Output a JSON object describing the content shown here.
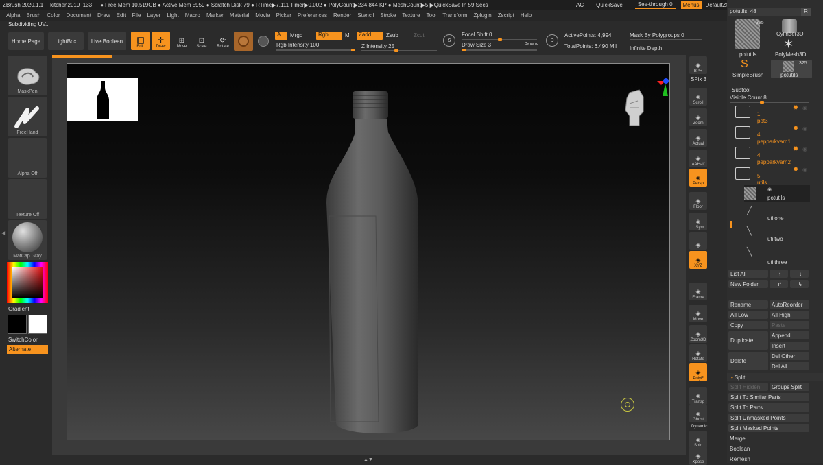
{
  "titlebar": {
    "app": "ZBrush 2020.1.1",
    "file": "kitchen2019_133",
    "stats": "● Free Mem 10.519GB ● Active Mem 5959 ● Scratch Disk 79 ● RTime▶7.111 Timer▶0.002 ● PolyCount▶234.844 KP ● MeshCount▶5 ▶QuickSave In 59 Secs",
    "ac": "AC",
    "quicksave": "QuickSave",
    "seethrough": "See-through  0",
    "menus": "Menus",
    "script": "DefaultZScript"
  },
  "menu": [
    "Alpha",
    "Brush",
    "Color",
    "Document",
    "Draw",
    "Edit",
    "File",
    "Layer",
    "Light",
    "Macro",
    "Marker",
    "Material",
    "Movie",
    "Picker",
    "Preferences",
    "Render",
    "Stencil",
    "Stroke",
    "Texture",
    "Tool",
    "Transform",
    "Zplugin",
    "Zscript",
    "Help"
  ],
  "subdividing": "Subdividing UV...",
  "toolbar": {
    "homepage": "Home Page",
    "lightbox": "LightBox",
    "liveboolean": "Live Boolean",
    "edit": "Edit",
    "draw": "Draw",
    "move": "Move",
    "scale": "Scale",
    "rotate": "Rotate",
    "a": "A",
    "mrgb": "Mrgb",
    "rgb": "Rgb",
    "m": "M",
    "zadd": "Zadd",
    "zsub": "Zsub",
    "zcut": "Zcut",
    "rgb_intensity": "Rgb Intensity 100",
    "z_intensity": "Z Intensity 25",
    "focal_shift": "Focal Shift 0",
    "draw_size": "Draw Size 3",
    "dynamic": "Dynamic",
    "active_points": "ActivePoints: 4,994",
    "total_points": "TotalPoints: 6.490 Mil",
    "mask_polygroups": "Mask By Polygroups 0",
    "infinite_depth": "Infinite Depth"
  },
  "left": {
    "maskpen": "MaskPen",
    "freehand": "FreeHand",
    "alpha_off": "Alpha Off",
    "texture_off": "Texture Off",
    "matcap": "MatCap Gray",
    "gradient": "Gradient",
    "switchcolor": "SwitchColor",
    "alternate": "Alternate"
  },
  "right_tools": [
    {
      "label": "BPR",
      "on": false
    },
    {
      "label": "Scroll",
      "on": false
    },
    {
      "label": "Zoom",
      "on": false
    },
    {
      "label": "Actual",
      "on": false
    },
    {
      "label": "AAHalf",
      "on": false
    },
    {
      "label": "Persp",
      "on": true
    },
    {
      "label": "Floor",
      "on": false
    },
    {
      "label": "L.Sym",
      "on": false
    },
    {
      "label": "",
      "on": false
    },
    {
      "label": "XYZ",
      "on": true
    },
    {
      "label": "Frame",
      "on": false
    },
    {
      "label": "Move",
      "on": false
    },
    {
      "label": "Zoom3D",
      "on": false
    },
    {
      "label": "Rotate",
      "on": false
    },
    {
      "label": "PolyF",
      "on": true
    },
    {
      "label": "Transp",
      "on": false
    },
    {
      "label": "Ghost",
      "on": false
    },
    {
      "label": "Solo",
      "on": false
    },
    {
      "label": "Xpose",
      "on": false
    }
  ],
  "spix": "SPix 3",
  "dynamic_label": "Dynamic",
  "panel": {
    "potutils_slider": "potutils. 48",
    "r": "R",
    "thumb_count": "325",
    "thumbs": [
      "potutils",
      "Cylinder3D",
      "PolyMesh3D",
      "SimpleBrush",
      "potutils"
    ],
    "thumb_count2": "325",
    "subtool": "Subtool",
    "visible_count": "Visible Count 8",
    "folders": [
      {
        "count": "1",
        "name": "pot3"
      },
      {
        "count": "4",
        "name": "pepparkvarn1"
      },
      {
        "count": "4",
        "name": "pepparkvarn2"
      },
      {
        "count": "5",
        "name": "utils"
      }
    ],
    "subtools": [
      "potutils",
      "utilone",
      "utiltwo",
      "utilthree"
    ],
    "list_all": "List All",
    "new_folder": "New Folder",
    "rename": "Rename",
    "autoreorder": "AutoReorder",
    "all_low": "All Low",
    "all_high": "All High",
    "copy": "Copy",
    "paste": "Paste",
    "duplicate": "Duplicate",
    "append": "Append",
    "insert": "Insert",
    "delete": "Delete",
    "del_other": "Del Other",
    "del_all": "Del All",
    "split": "Split",
    "split_hidden": "Split Hidden",
    "groups_split": "Groups Split",
    "split_similar": "Split To Similar Parts",
    "split_parts": "Split To Parts",
    "split_unmasked": "Split Unmasked Points",
    "split_masked": "Split Masked Points",
    "merge": "Merge",
    "boolean": "Boolean",
    "remesh": "Remesh"
  }
}
